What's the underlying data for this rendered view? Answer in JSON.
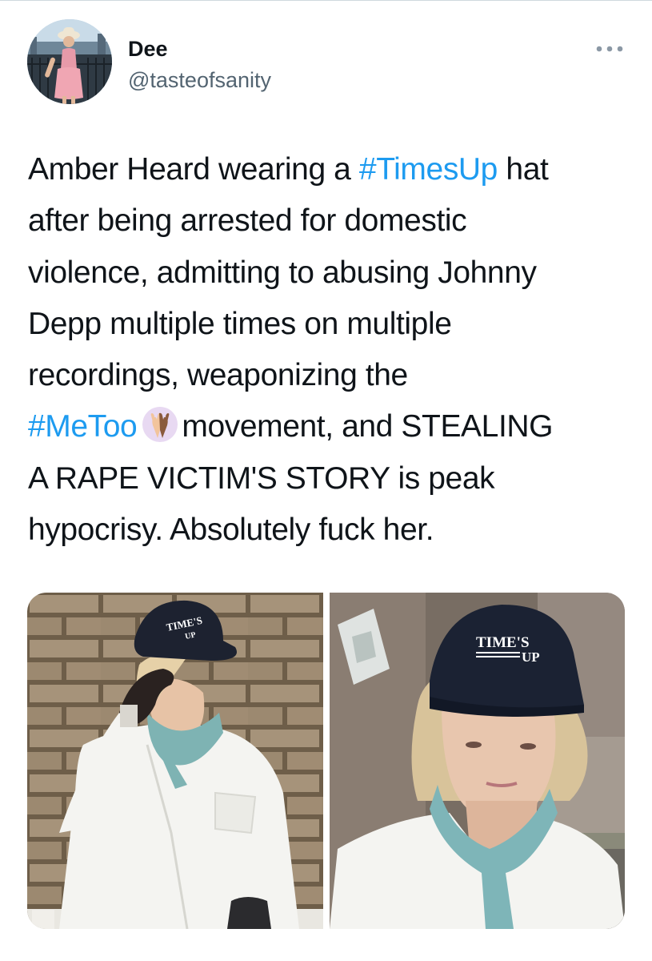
{
  "author": {
    "display_name": "Dee",
    "handle": "@tasteofsanity"
  },
  "more_icon": "more-horizontal-icon",
  "tweet": {
    "lines": [
      [
        {
          "text": "Amber Heard wearing a ",
          "type": "text"
        },
        {
          "text": "#TimesUp",
          "type": "hashtag"
        },
        {
          "text": " hat",
          "type": "text"
        }
      ],
      [
        {
          "text": "after being arrested for domestic",
          "type": "text"
        }
      ],
      [
        {
          "text": "violence, admitting to abusing Johnny",
          "type": "text"
        }
      ],
      [
        {
          "text": "Depp multiple times on multiple",
          "type": "text"
        }
      ],
      [
        {
          "text": "recordings, weaponizing the",
          "type": "text"
        }
      ],
      [
        {
          "text": "#MeToo",
          "type": "hashtag"
        },
        {
          "text": "",
          "type": "emoji",
          "name": "raised-hands-emoji"
        },
        {
          "text": "movement, and STEALING",
          "type": "text"
        }
      ],
      [
        {
          "text": "A RAPE VICTIM'S STORY is peak",
          "type": "text"
        }
      ],
      [
        {
          "text": "hypocrisy. Absolutely fuck her.",
          "type": "text"
        }
      ]
    ]
  },
  "media": {
    "photos": [
      {
        "name": "photo-woman-in-cap-by-brick-wall",
        "cap_text_1": "TIME'S",
        "cap_text_2": "UP"
      },
      {
        "name": "photo-woman-in-cap-closeup",
        "cap_text_1": "TIME'S",
        "cap_text_2": "UP"
      }
    ]
  },
  "colors": {
    "hashtag": "#1d9bf0",
    "text": "#0f1419",
    "secondary": "#536471"
  }
}
